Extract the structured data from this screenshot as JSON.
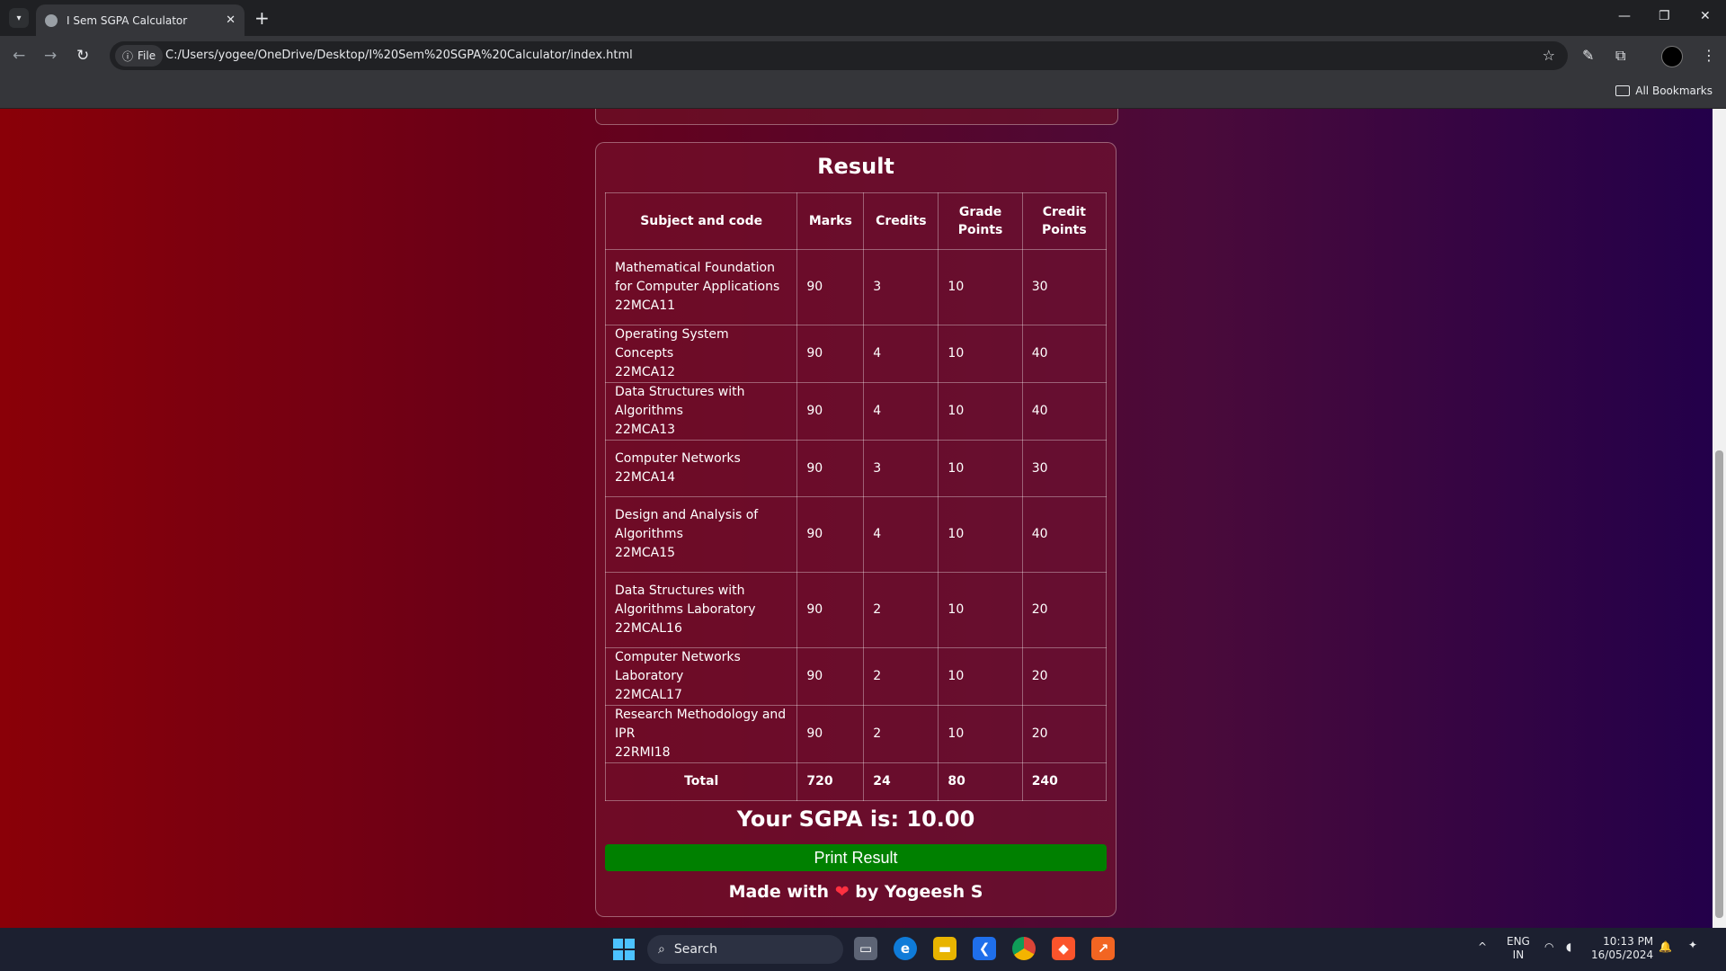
{
  "browser": {
    "tab_title": "I Sem SGPA Calculator",
    "file_chip": "File",
    "url": "C:/Users/yogee/OneDrive/Desktop/I%20Sem%20SGPA%20Calculator/index.html",
    "all_bookmarks": "All Bookmarks"
  },
  "result": {
    "title": "Result",
    "headers": [
      "Subject and code",
      "Marks",
      "Credits",
      "Grade Points",
      "Credit Points"
    ],
    "rows": [
      {
        "subject": "Mathematical Foundation for Computer Applications",
        "code": "22MCA11",
        "marks": "90",
        "credits": "3",
        "grade_points": "10",
        "credit_points": "30"
      },
      {
        "subject": "Operating System Concepts",
        "code": "22MCA12",
        "marks": "90",
        "credits": "4",
        "grade_points": "10",
        "credit_points": "40"
      },
      {
        "subject": "Data Structures with Algorithms",
        "code": "22MCA13",
        "marks": "90",
        "credits": "4",
        "grade_points": "10",
        "credit_points": "40"
      },
      {
        "subject": "Computer Networks",
        "code": "22MCA14",
        "marks": "90",
        "credits": "3",
        "grade_points": "10",
        "credit_points": "30"
      },
      {
        "subject": "Design and Analysis of Algorithms",
        "code": "22MCA15",
        "marks": "90",
        "credits": "4",
        "grade_points": "10",
        "credit_points": "40"
      },
      {
        "subject": "Data Structures with Algorithms Laboratory",
        "code": "22MCAL16",
        "marks": "90",
        "credits": "2",
        "grade_points": "10",
        "credit_points": "20"
      },
      {
        "subject": "Computer Networks Laboratory",
        "code": "22MCAL17",
        "marks": "90",
        "credits": "2",
        "grade_points": "10",
        "credit_points": "20"
      },
      {
        "subject": "Research Methodology and IPR",
        "code": "22RMI18",
        "marks": "90",
        "credits": "2",
        "grade_points": "10",
        "credit_points": "20"
      }
    ],
    "total": {
      "label": "Total",
      "marks": "720",
      "credits": "24",
      "grade_points": "80",
      "credit_points": "240"
    },
    "sgpa_text": "Your SGPA is: 10.00",
    "print_button": "Print Result",
    "footer_prefix": "Made with",
    "footer_heart": "❤",
    "footer_suffix": "by Yogeesh S"
  },
  "taskbar": {
    "search_label": "Search",
    "lang": "ENG",
    "region": "IN",
    "time": "10:13 PM",
    "date": "16/05/2024"
  },
  "colors": {
    "print_button": "#008000",
    "accent_blue": "#4cc2ff"
  }
}
